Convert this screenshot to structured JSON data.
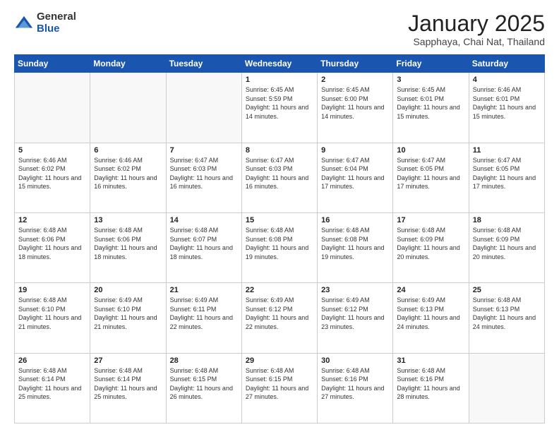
{
  "logo": {
    "general": "General",
    "blue": "Blue"
  },
  "header": {
    "month": "January 2025",
    "location": "Sapphaya, Chai Nat, Thailand"
  },
  "weekdays": [
    "Sunday",
    "Monday",
    "Tuesday",
    "Wednesday",
    "Thursday",
    "Friday",
    "Saturday"
  ],
  "weeks": [
    [
      {
        "day": "",
        "sunrise": "",
        "sunset": "",
        "daylight": ""
      },
      {
        "day": "",
        "sunrise": "",
        "sunset": "",
        "daylight": ""
      },
      {
        "day": "",
        "sunrise": "",
        "sunset": "",
        "daylight": ""
      },
      {
        "day": "1",
        "sunrise": "Sunrise: 6:45 AM",
        "sunset": "Sunset: 5:59 PM",
        "daylight": "Daylight: 11 hours and 14 minutes."
      },
      {
        "day": "2",
        "sunrise": "Sunrise: 6:45 AM",
        "sunset": "Sunset: 6:00 PM",
        "daylight": "Daylight: 11 hours and 14 minutes."
      },
      {
        "day": "3",
        "sunrise": "Sunrise: 6:45 AM",
        "sunset": "Sunset: 6:01 PM",
        "daylight": "Daylight: 11 hours and 15 minutes."
      },
      {
        "day": "4",
        "sunrise": "Sunrise: 6:46 AM",
        "sunset": "Sunset: 6:01 PM",
        "daylight": "Daylight: 11 hours and 15 minutes."
      }
    ],
    [
      {
        "day": "5",
        "sunrise": "Sunrise: 6:46 AM",
        "sunset": "Sunset: 6:02 PM",
        "daylight": "Daylight: 11 hours and 15 minutes."
      },
      {
        "day": "6",
        "sunrise": "Sunrise: 6:46 AM",
        "sunset": "Sunset: 6:02 PM",
        "daylight": "Daylight: 11 hours and 16 minutes."
      },
      {
        "day": "7",
        "sunrise": "Sunrise: 6:47 AM",
        "sunset": "Sunset: 6:03 PM",
        "daylight": "Daylight: 11 hours and 16 minutes."
      },
      {
        "day": "8",
        "sunrise": "Sunrise: 6:47 AM",
        "sunset": "Sunset: 6:03 PM",
        "daylight": "Daylight: 11 hours and 16 minutes."
      },
      {
        "day": "9",
        "sunrise": "Sunrise: 6:47 AM",
        "sunset": "Sunset: 6:04 PM",
        "daylight": "Daylight: 11 hours and 17 minutes."
      },
      {
        "day": "10",
        "sunrise": "Sunrise: 6:47 AM",
        "sunset": "Sunset: 6:05 PM",
        "daylight": "Daylight: 11 hours and 17 minutes."
      },
      {
        "day": "11",
        "sunrise": "Sunrise: 6:47 AM",
        "sunset": "Sunset: 6:05 PM",
        "daylight": "Daylight: 11 hours and 17 minutes."
      }
    ],
    [
      {
        "day": "12",
        "sunrise": "Sunrise: 6:48 AM",
        "sunset": "Sunset: 6:06 PM",
        "daylight": "Daylight: 11 hours and 18 minutes."
      },
      {
        "day": "13",
        "sunrise": "Sunrise: 6:48 AM",
        "sunset": "Sunset: 6:06 PM",
        "daylight": "Daylight: 11 hours and 18 minutes."
      },
      {
        "day": "14",
        "sunrise": "Sunrise: 6:48 AM",
        "sunset": "Sunset: 6:07 PM",
        "daylight": "Daylight: 11 hours and 18 minutes."
      },
      {
        "day": "15",
        "sunrise": "Sunrise: 6:48 AM",
        "sunset": "Sunset: 6:08 PM",
        "daylight": "Daylight: 11 hours and 19 minutes."
      },
      {
        "day": "16",
        "sunrise": "Sunrise: 6:48 AM",
        "sunset": "Sunset: 6:08 PM",
        "daylight": "Daylight: 11 hours and 19 minutes."
      },
      {
        "day": "17",
        "sunrise": "Sunrise: 6:48 AM",
        "sunset": "Sunset: 6:09 PM",
        "daylight": "Daylight: 11 hours and 20 minutes."
      },
      {
        "day": "18",
        "sunrise": "Sunrise: 6:48 AM",
        "sunset": "Sunset: 6:09 PM",
        "daylight": "Daylight: 11 hours and 20 minutes."
      }
    ],
    [
      {
        "day": "19",
        "sunrise": "Sunrise: 6:48 AM",
        "sunset": "Sunset: 6:10 PM",
        "daylight": "Daylight: 11 hours and 21 minutes."
      },
      {
        "day": "20",
        "sunrise": "Sunrise: 6:49 AM",
        "sunset": "Sunset: 6:10 PM",
        "daylight": "Daylight: 11 hours and 21 minutes."
      },
      {
        "day": "21",
        "sunrise": "Sunrise: 6:49 AM",
        "sunset": "Sunset: 6:11 PM",
        "daylight": "Daylight: 11 hours and 22 minutes."
      },
      {
        "day": "22",
        "sunrise": "Sunrise: 6:49 AM",
        "sunset": "Sunset: 6:12 PM",
        "daylight": "Daylight: 11 hours and 22 minutes."
      },
      {
        "day": "23",
        "sunrise": "Sunrise: 6:49 AM",
        "sunset": "Sunset: 6:12 PM",
        "daylight": "Daylight: 11 hours and 23 minutes."
      },
      {
        "day": "24",
        "sunrise": "Sunrise: 6:49 AM",
        "sunset": "Sunset: 6:13 PM",
        "daylight": "Daylight: 11 hours and 24 minutes."
      },
      {
        "day": "25",
        "sunrise": "Sunrise: 6:48 AM",
        "sunset": "Sunset: 6:13 PM",
        "daylight": "Daylight: 11 hours and 24 minutes."
      }
    ],
    [
      {
        "day": "26",
        "sunrise": "Sunrise: 6:48 AM",
        "sunset": "Sunset: 6:14 PM",
        "daylight": "Daylight: 11 hours and 25 minutes."
      },
      {
        "day": "27",
        "sunrise": "Sunrise: 6:48 AM",
        "sunset": "Sunset: 6:14 PM",
        "daylight": "Daylight: 11 hours and 25 minutes."
      },
      {
        "day": "28",
        "sunrise": "Sunrise: 6:48 AM",
        "sunset": "Sunset: 6:15 PM",
        "daylight": "Daylight: 11 hours and 26 minutes."
      },
      {
        "day": "29",
        "sunrise": "Sunrise: 6:48 AM",
        "sunset": "Sunset: 6:15 PM",
        "daylight": "Daylight: 11 hours and 27 minutes."
      },
      {
        "day": "30",
        "sunrise": "Sunrise: 6:48 AM",
        "sunset": "Sunset: 6:16 PM",
        "daylight": "Daylight: 11 hours and 27 minutes."
      },
      {
        "day": "31",
        "sunrise": "Sunrise: 6:48 AM",
        "sunset": "Sunset: 6:16 PM",
        "daylight": "Daylight: 11 hours and 28 minutes."
      },
      {
        "day": "",
        "sunrise": "",
        "sunset": "",
        "daylight": ""
      }
    ]
  ]
}
